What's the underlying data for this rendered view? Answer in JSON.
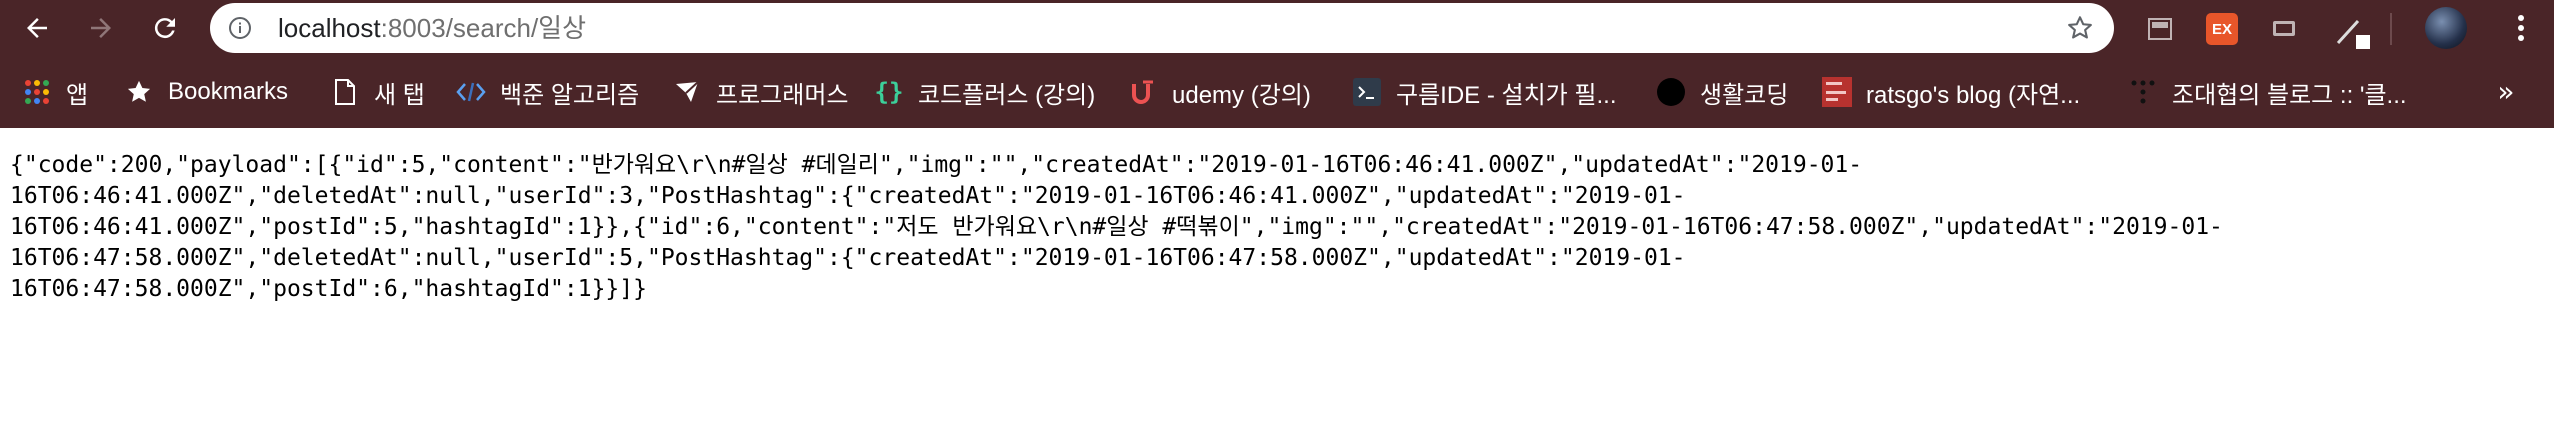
{
  "browser": {
    "url_host": "localhost",
    "url_rest": ":8003/search/일상",
    "ext_badge": "EX",
    "colors": {
      "frame": "#4a2528",
      "omnibox": "#ffffff",
      "ext_badge": "#e8562a"
    }
  },
  "bookmarks": [
    {
      "label": "앱",
      "icon": "apps-grid-icon"
    },
    {
      "label": "Bookmarks",
      "icon": "star-icon"
    },
    {
      "label": "새 탭",
      "icon": "page-icon"
    },
    {
      "label": "백준 알고리즘",
      "icon": "code-bracket-icon"
    },
    {
      "label": "프로그래머스",
      "icon": "programmers-icon"
    },
    {
      "label": "코드플러스 (강의)",
      "icon": "curly-brace-icon"
    },
    {
      "label": "udemy (강의)",
      "icon": "udemy-icon"
    },
    {
      "label": "구름IDE - 설치가 필...",
      "icon": "terminal-icon"
    },
    {
      "label": "생활코딩",
      "icon": "black-circle-icon"
    },
    {
      "label": "ratsgo's blog (자연...",
      "icon": "nlp-blog-icon"
    },
    {
      "label": "조대협의 블로그 :: '클...",
      "icon": "dots-icon"
    }
  ],
  "json_lines": [
    "{\"code\":200,\"payload\":[{\"id\":5,\"content\":\"반가워요\\r\\n#일상 #데일리\",\"img\":\"\",\"createdAt\":\"2019-01-16T06:46:41.000Z\",\"updatedAt\":\"2019-01-",
    "16T06:46:41.000Z\",\"deletedAt\":null,\"userId\":3,\"PostHashtag\":{\"createdAt\":\"2019-01-16T06:46:41.000Z\",\"updatedAt\":\"2019-01-",
    "16T06:46:41.000Z\",\"postId\":5,\"hashtagId\":1}},{\"id\":6,\"content\":\"저도 반가워요\\r\\n#일상 #떡볶이\",\"img\":\"\",\"createdAt\":\"2019-01-16T06:47:58.000Z\",\"updatedAt\":\"2019-01-",
    "16T06:47:58.000Z\",\"deletedAt\":null,\"userId\":5,\"PostHashtag\":{\"createdAt\":\"2019-01-16T06:47:58.000Z\",\"updatedAt\":\"2019-01-",
    "16T06:47:58.000Z\",\"postId\":6,\"hashtagId\":1}}]}"
  ]
}
